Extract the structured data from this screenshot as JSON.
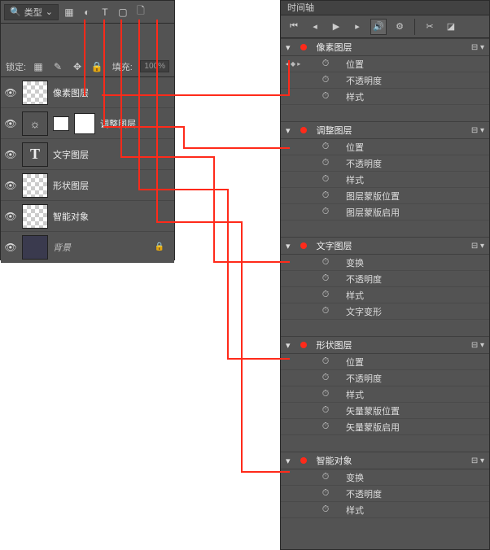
{
  "layers_panel": {
    "filter_label": "类型",
    "filter_icons": [
      "image-icon",
      "adjust-icon",
      "text-icon",
      "shape-icon",
      "smart-icon"
    ],
    "lock_label": "锁定:",
    "fill_label": "填充:",
    "fill_value": "100%",
    "rows": [
      {
        "name": "像素图层",
        "eye": "👁",
        "thumb": "checker"
      },
      {
        "name": "调整图层",
        "eye": "👁",
        "thumb": "adj",
        "hasMask": true
      },
      {
        "name": "文字图层",
        "eye": "👁",
        "thumb": "text"
      },
      {
        "name": "形状图层",
        "eye": "👁",
        "thumb": "checker"
      },
      {
        "name": "智能对象",
        "eye": "👁",
        "thumb": "checker"
      },
      {
        "name": "背景",
        "eye": "👁",
        "thumb": "dark",
        "italic": true,
        "locked": true
      }
    ]
  },
  "timeline_panel": {
    "title": "时间轴",
    "groups": [
      {
        "name": "像素图层",
        "props": [
          "位置",
          "不透明度",
          "样式"
        ],
        "firstKf": true
      },
      {
        "name": "调整图层",
        "props": [
          "位置",
          "不透明度",
          "样式",
          "图层蒙版位置",
          "图层蒙版启用"
        ]
      },
      {
        "name": "文字图层",
        "props": [
          "变换",
          "不透明度",
          "样式",
          "文字变形"
        ]
      },
      {
        "name": "形状图层",
        "props": [
          "位置",
          "不透明度",
          "样式",
          "矢量蒙版位置",
          "矢量蒙版启用"
        ]
      },
      {
        "name": "智能对象",
        "props": [
          "变换",
          "不透明度",
          "样式"
        ]
      }
    ]
  }
}
